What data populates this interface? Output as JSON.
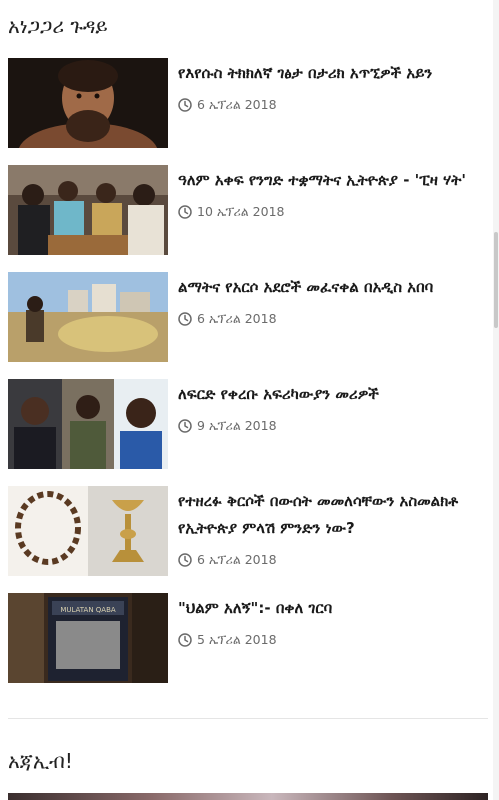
{
  "section": {
    "title": "አነጋጋሪ ጉዳይ"
  },
  "articles": [
    {
      "title": "የእየሱስ ትክክለኛ ገፅታ በታሪክ አጥኚዎች አይን",
      "date": "6 ኤፕሪል 2018"
    },
    {
      "title": "ዓለም አቀፍ የንግድ ተቋማትና ኢትዮጵያ - 'ፒዛ ሃት'",
      "date": "10 ኤፕሪል 2018"
    },
    {
      "title": "ልማትና የአርሶ አደሮች መፈናቀል በአዲስ አበባ",
      "date": "6 ኤፕሪል 2018"
    },
    {
      "title": "ለፍርድ የቀረቡ አፍሪካውያን መሪዎች",
      "date": "9 ኤፕሪል 2018"
    },
    {
      "title": "የተዘረፉ ቅርሶች በውሰት መመለሳቸውን አስመልክቶ የኢትዮጵያ ምላሽ ምንድን ነው?",
      "date": "6 ኤፕሪል 2018"
    },
    {
      "title": "\"ህልም አለኝ\":- በቀለ ገርባ",
      "date": "5 ኤፕሪል 2018"
    }
  ],
  "book_cover_text": "MULATAN QABA",
  "section2": {
    "title": "አጃኢብ!"
  },
  "icons": {
    "date": "clock-icon"
  }
}
